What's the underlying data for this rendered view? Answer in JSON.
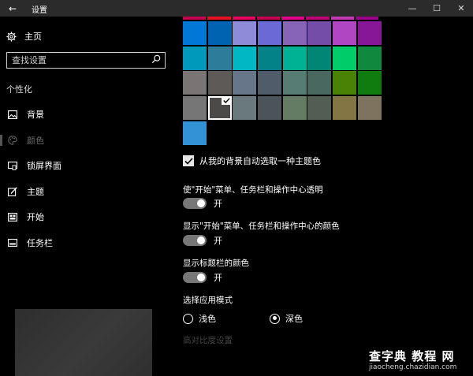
{
  "window": {
    "title": "设置",
    "back_glyph": "←",
    "minimize_glyph": "—",
    "maximize_glyph": "☐",
    "close_glyph": "✕"
  },
  "sidebar": {
    "home_label": "主页",
    "search_placeholder": "查找设置",
    "section_label": "个性化",
    "items": [
      {
        "label": "背景",
        "icon": "picture-icon",
        "active": false
      },
      {
        "label": "颜色",
        "icon": "palette-icon",
        "active": true
      },
      {
        "label": "锁屏界面",
        "icon": "lock-screen-icon",
        "active": false
      },
      {
        "label": "主题",
        "icon": "theme-brush-icon",
        "active": false
      },
      {
        "label": "开始",
        "icon": "start-icon",
        "active": false
      },
      {
        "label": "任务栏",
        "icon": "taskbar-icon",
        "active": false
      }
    ]
  },
  "colors": {
    "top_strip": [
      "#c30052",
      "#e81123",
      "#ea005e",
      "#c30052",
      "#e3008c",
      "#bf0077",
      "#c239b3",
      "#9a0089"
    ],
    "rows": [
      [
        "#0078d7",
        "#0063b1",
        "#8e8cd8",
        "#6b69d6",
        "#8764b8",
        "#744da9",
        "#b146c2",
        "#881798"
      ],
      [
        "#0099bc",
        "#2d7d9a",
        "#00b7c3",
        "#038387",
        "#00b294",
        "#018574",
        "#00cc6a",
        "#10893e"
      ],
      [
        "#7a7574",
        "#5d5a58",
        "#68768a",
        "#515c6b",
        "#567c73",
        "#486860",
        "#498205",
        "#107c10"
      ],
      [
        "#767676",
        "#4c4a48",
        "#69797e",
        "#4a5459",
        "#647c64",
        "#525e54",
        "#847545",
        "#7e735f"
      ],
      [
        "#3392d6"
      ]
    ],
    "selected": "#4c4a48"
  },
  "settings": {
    "auto_pick_label": "从我的背景自动选取一种主题色",
    "transparency_label": "使\"开始\"菜单、任务栏和操作中心透明",
    "transparency_state": "开",
    "show_color_start_label": "显示\"开始\"菜单、任务栏和操作中心的颜色",
    "show_color_start_state": "开",
    "show_titlebar_color_label": "显示标题栏的颜色",
    "show_titlebar_color_state": "开",
    "app_mode_label": "选择应用模式",
    "light_label": "浅色",
    "dark_label": "深色",
    "high_contrast_link": "高对比度设置"
  },
  "watermark": {
    "line1": "查字典 教程 网",
    "line2": "jiaocheng.chazidian.com"
  }
}
